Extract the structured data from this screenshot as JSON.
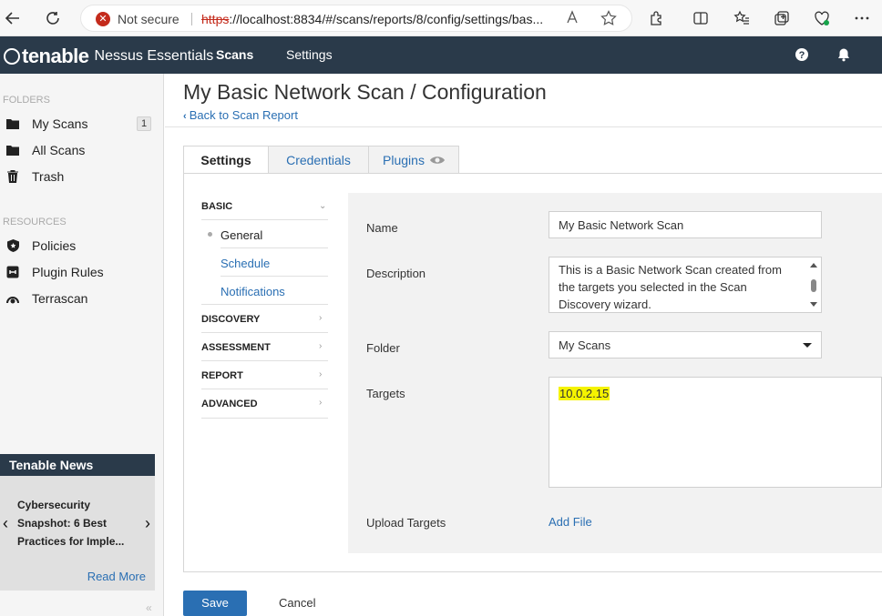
{
  "browser": {
    "security_label": "Not secure",
    "url_protocol": "https",
    "url_rest": "://localhost:8834/#/scans/reports/8/config/settings/bas..."
  },
  "header": {
    "brand": "tenable",
    "product": "Nessus Essentials",
    "nav": [
      "Scans",
      "Settings"
    ]
  },
  "sidebar": {
    "folders_heading": "FOLDERS",
    "folders": [
      {
        "label": "My Scans",
        "count": "1",
        "icon": "folder-icon"
      },
      {
        "label": "All Scans",
        "icon": "folder-icon"
      },
      {
        "label": "Trash",
        "icon": "trash-icon"
      }
    ],
    "resources_heading": "RESOURCES",
    "resources": [
      {
        "label": "Policies",
        "icon": "shield-icon"
      },
      {
        "label": "Plugin Rules",
        "icon": "plugin-rules-icon"
      },
      {
        "label": "Terrascan",
        "icon": "terrascan-icon"
      }
    ],
    "news": {
      "title": "Tenable News",
      "headline": "Cybersecurity Snapshot: 6 Best Practices for Imple...",
      "read_more": "Read More"
    }
  },
  "main": {
    "title": "My Basic Network Scan / Configuration",
    "back_link": "Back to Scan Report",
    "tabs": [
      "Settings",
      "Credentials",
      "Plugins"
    ],
    "settings_nav": {
      "basic": "BASIC",
      "basic_items": [
        "General",
        "Schedule",
        "Notifications"
      ],
      "sections": [
        "DISCOVERY",
        "ASSESSMENT",
        "REPORT",
        "ADVANCED"
      ]
    },
    "form": {
      "name_label": "Name",
      "name_value": "My Basic Network Scan",
      "description_label": "Description",
      "description_value": "This is a Basic Network Scan created from the targets you selected in the Scan Discovery wizard.",
      "folder_label": "Folder",
      "folder_value": "My Scans",
      "targets_label": "Targets",
      "targets_value": "10.0.2.15",
      "upload_label": "Upload Targets",
      "add_file": "Add File"
    },
    "save": "Save",
    "cancel": "Cancel"
  }
}
